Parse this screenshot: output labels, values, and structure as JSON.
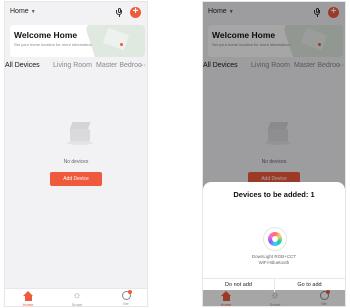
{
  "topbar": {
    "home_label": "Home"
  },
  "welcome": {
    "title": "Welcome Home",
    "subtitle": "Set your home location for more information"
  },
  "tabs": {
    "all": "All Devices",
    "living": "Living Room",
    "master": "Master Bedroo",
    "more": "···"
  },
  "empty": {
    "message": "No devices",
    "add_button": "Add Device"
  },
  "tabbar": {
    "home": "Home",
    "smart": "Smart",
    "me": "Me"
  },
  "popup": {
    "title": "Devices to be added: 1",
    "device_name_line1": "DownLight RGB+CCT",
    "device_name_line2": "WiFi+Bluetooth",
    "cancel": "Do not add",
    "confirm": "Go to add"
  },
  "colors": {
    "accent": "#ee5a3c",
    "background": "#f2f2f4"
  }
}
